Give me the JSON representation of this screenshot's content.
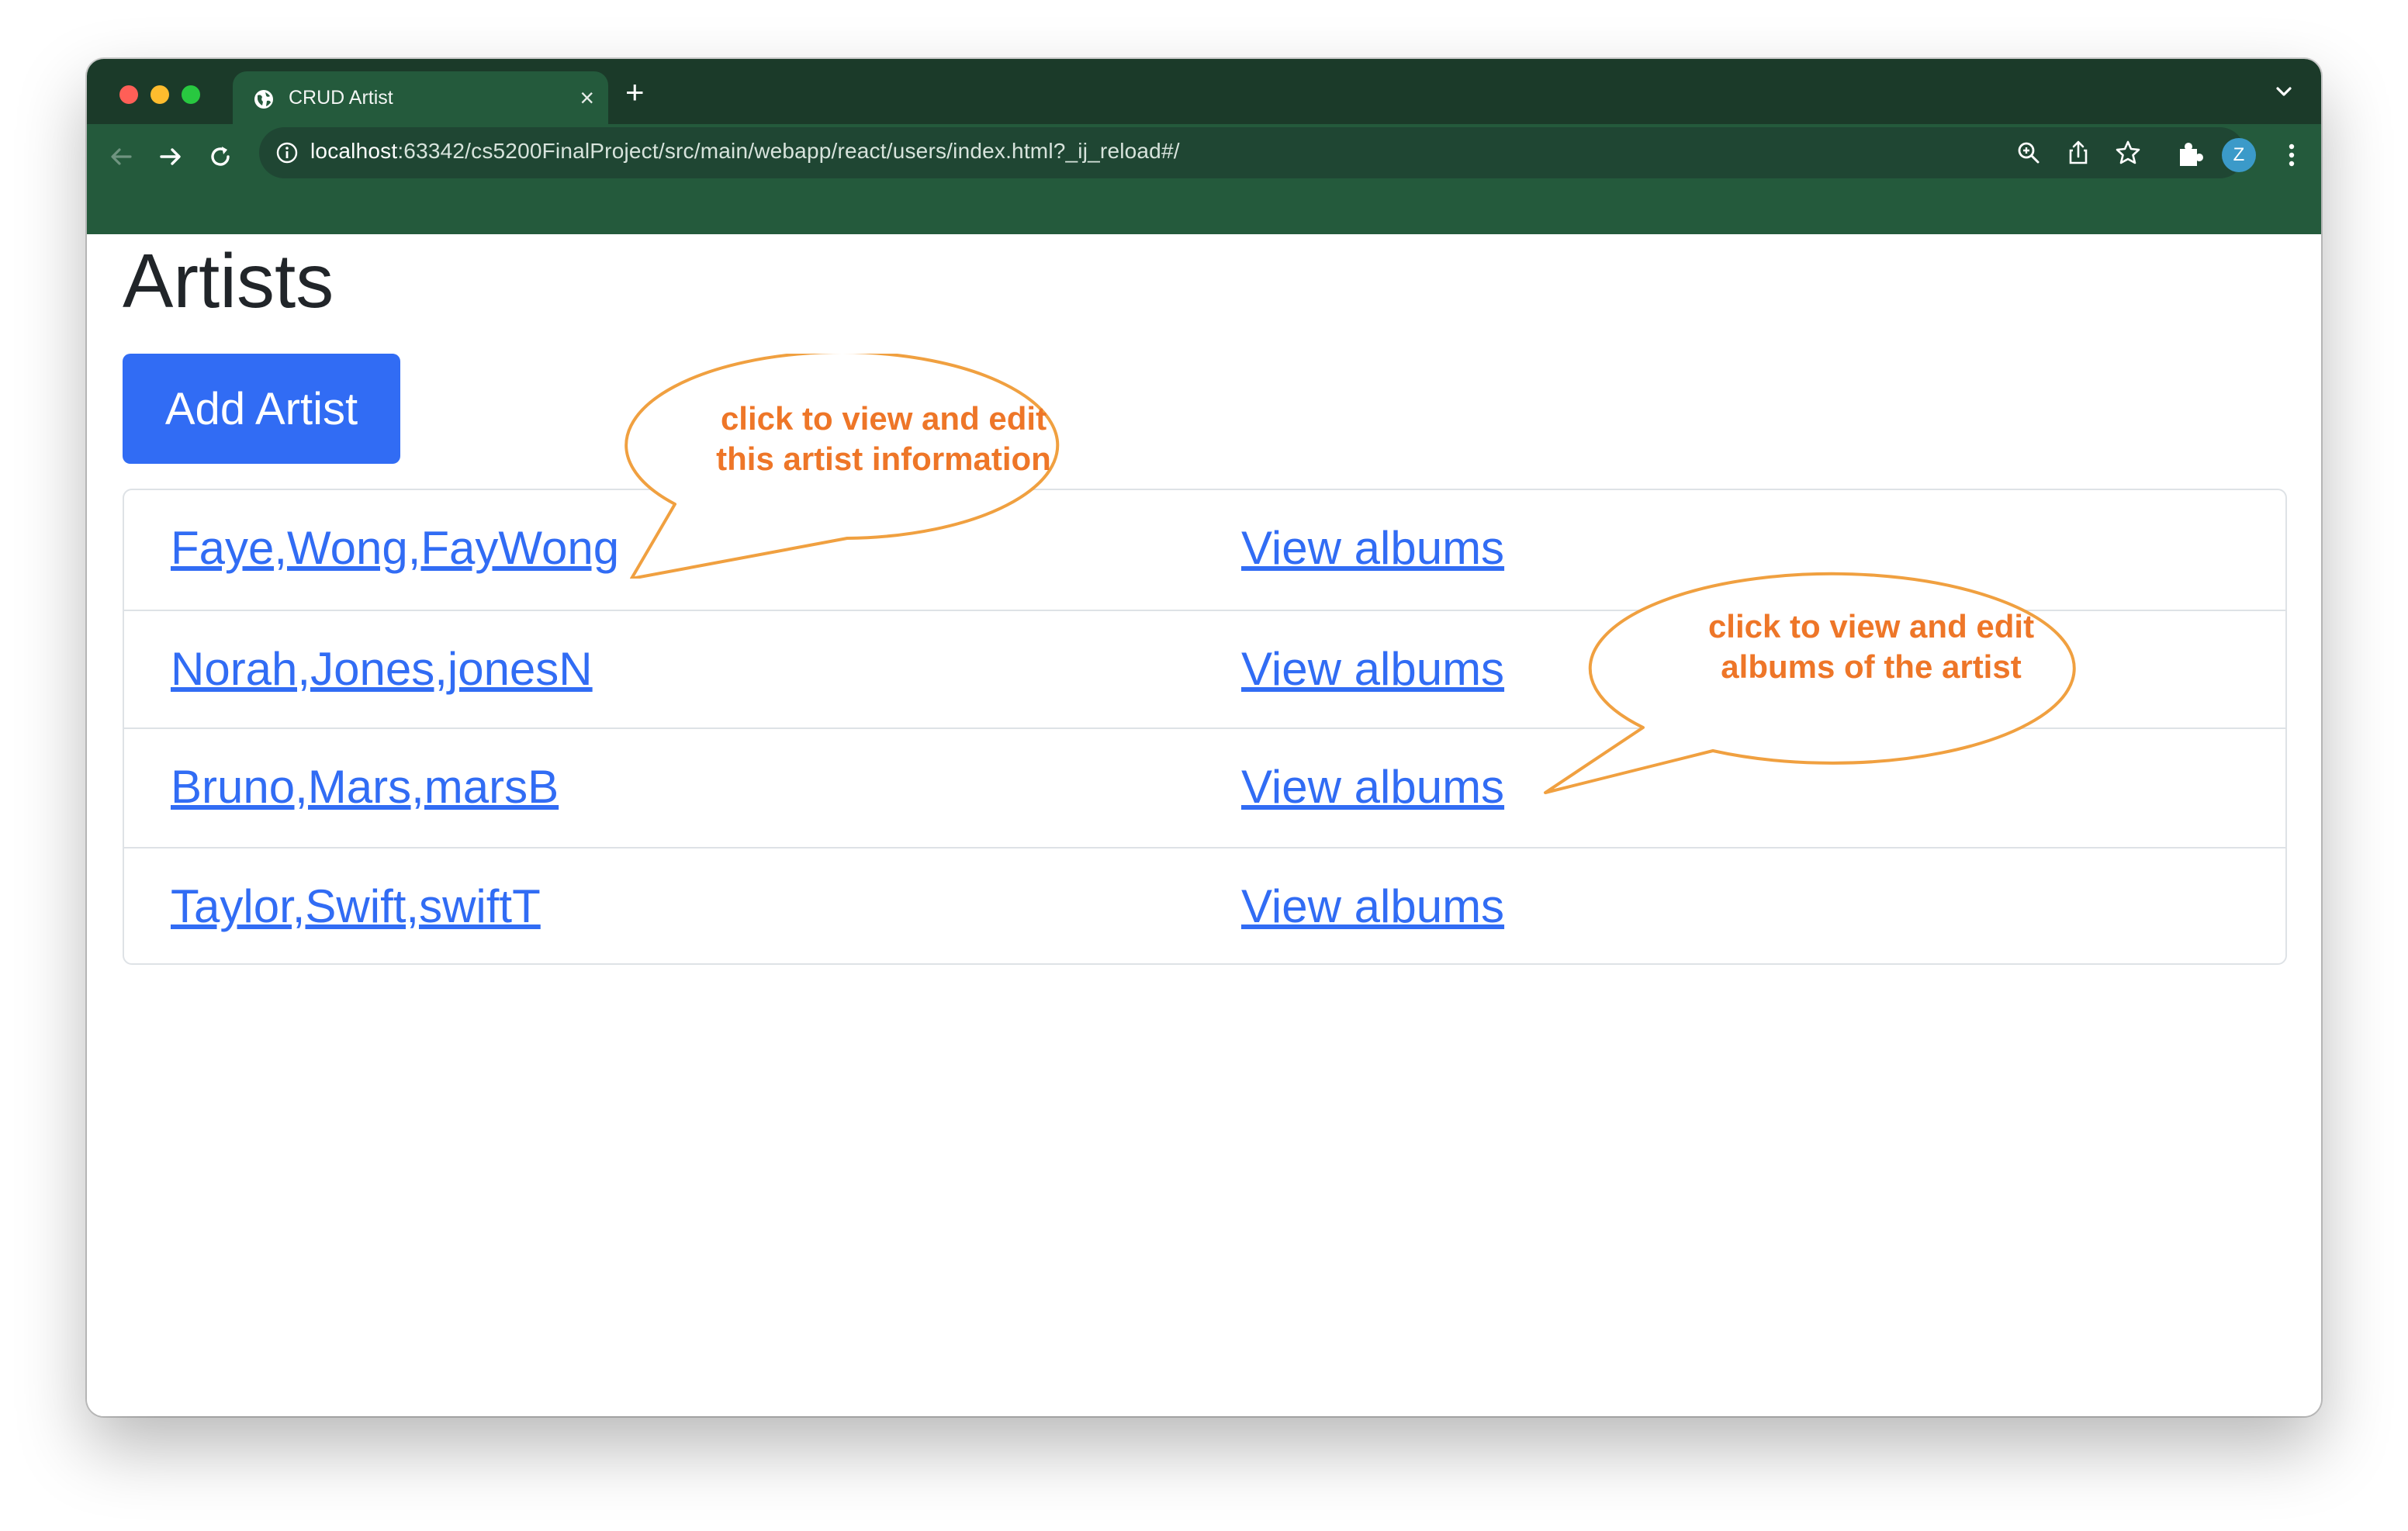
{
  "browser": {
    "tab_title": "CRUD Artist",
    "new_tab_symbol": "+",
    "close_symbol": "×",
    "url_host": "localhost",
    "url_rest": ":63342/cs5200FinalProject/src/main/webapp/react/users/index.html?_ij_reload#/",
    "profile_initial": "Z",
    "icons": [
      "globe-icon",
      "back-icon",
      "forward-icon",
      "reload-icon",
      "info-icon",
      "zoom-icon",
      "share-icon",
      "star-icon",
      "extensions-icon",
      "kebab-menu-icon",
      "chevron-down-icon"
    ]
  },
  "page": {
    "heading": "Artists",
    "add_button_label": "Add Artist",
    "artists": [
      {
        "name": "Faye,Wong,FayWong",
        "albums_label": "View albums"
      },
      {
        "name": "Norah,Jones,jonesN",
        "albums_label": "View albums"
      },
      {
        "name": "Bruno,Mars,marsB",
        "albums_label": "View albums"
      },
      {
        "name": "Taylor,Swift,swiftT",
        "albums_label": "View albums"
      }
    ]
  },
  "annotations": {
    "artist_callout": [
      "click to view and edit",
      "this artist information"
    ],
    "albums_callout": [
      "click to view and edit",
      "albums of the artist"
    ],
    "color": "#ee7628",
    "stroke": "#f0a040"
  },
  "colors": {
    "chrome_dark": "#1b3a29",
    "chrome": "#245a3c",
    "link": "#316cf4",
    "button": "#316cf4"
  }
}
